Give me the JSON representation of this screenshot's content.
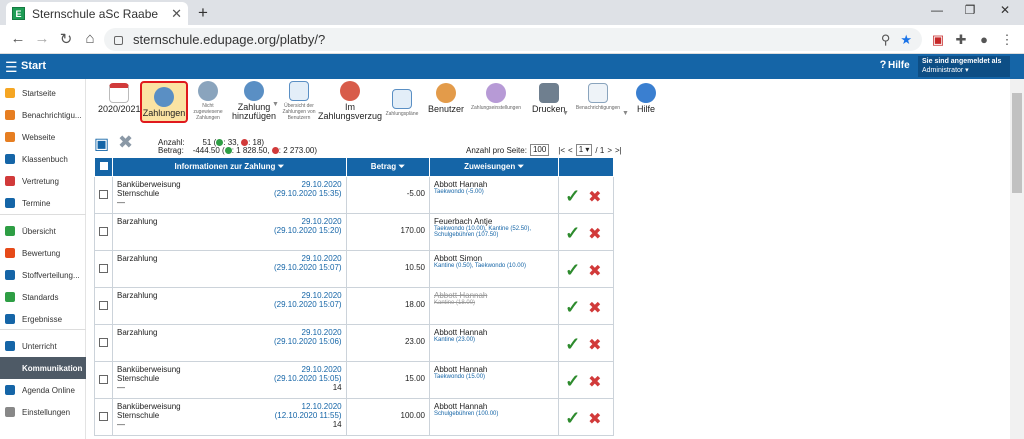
{
  "browser": {
    "tab_title": "Sternschule aSc Raabe",
    "url": "sternschule.edupage.org/platby/?",
    "tab_close": "✕",
    "newtab": "+"
  },
  "header": {
    "start": "Start",
    "help": "Hilfe",
    "user_line1": "Sie sind angemeldet als",
    "user_line2": "Administrator"
  },
  "sidebar": {
    "items": [
      "Startseite",
      "Benachrichtigu...",
      "Webseite",
      "Klassenbuch",
      "Vertretung",
      "Termine",
      "Übersicht",
      "Bewertung",
      "Stoffverteilung...",
      "Standards",
      "Ergebnisse",
      "Unterricht",
      "Kommunikation",
      "Agenda Online",
      "Einstellungen"
    ],
    "colors": [
      "#f5a623",
      "#e67e22",
      "#e67e22",
      "#1565a7",
      "#d13a3a",
      "#1565a7",
      "#2e9e44",
      "#e64a19",
      "#1565a7",
      "#2e9e44",
      "#1565a7",
      "#1565a7",
      "#4e5a66",
      "#1565a7",
      "#888888"
    ]
  },
  "toolbar": {
    "year": "2020/2021",
    "zahlungen": "Zahlungen",
    "nicht": "Nicht zugewiesene Zahlungen",
    "hinzu": "Zahlung hinzufügen",
    "uebersicht": "Übersicht der Zahlungen von Benutzern",
    "verzug": "Im Zahlungsverzug",
    "plaene": "Zahlungspläne",
    "benutzer": "Benutzer",
    "einst": "Zahlungseinstellungen",
    "drucken": "Drucken",
    "benach": "Benachrichtigungen",
    "hilfe": "Hilfe"
  },
  "summary": {
    "anzahl_label": "Anzahl:",
    "anzahl": "51",
    "anzahl_pos": "33,",
    "anzahl_neg": "18)",
    "betrag_label": "Betrag:",
    "betrag": "-444.50",
    "betrag_pos": "1 828.50,",
    "betrag_neg": "2 273.00)"
  },
  "pagination": {
    "per_page_label": "Anzahl pro Seite:",
    "per_page": "100",
    "first": "|<",
    "prev": "<",
    "page": "1",
    "total": "/ 1",
    "next": ">",
    "last": ">|"
  },
  "table": {
    "headers": {
      "info": "Informationen zur Zahlung",
      "betrag": "Betrag",
      "zuweisungen": "Zuweisungen"
    },
    "rows": [
      {
        "type": "Banküberweisung",
        "type2": "Sternschule",
        "extra": "—",
        "date": "29.10.2020",
        "date2": "(29.10.2020 15:35)",
        "num": "",
        "amount": "-5.00",
        "name": "Abbott Hannah",
        "detail": "Taekwondo (-5.00)",
        "detail2": ""
      },
      {
        "type": "Barzahlung",
        "type2": "",
        "extra": "",
        "date": "29.10.2020",
        "date2": "(29.10.2020 15:20)",
        "num": "",
        "amount": "170.00",
        "name": "Feuerbach Antje",
        "detail": "Taekwondo (10.00), Kantine (52.50),",
        "detail2": "Schulgebühren (107.50)"
      },
      {
        "type": "Barzahlung",
        "type2": "",
        "extra": "",
        "date": "29.10.2020",
        "date2": "(29.10.2020 15:07)",
        "num": "",
        "amount": "10.50",
        "name": "Abbott Simon",
        "detail": "Kantine (0.50), Taekwondo (10.00)",
        "detail2": ""
      },
      {
        "type": "Barzahlung",
        "type2": "",
        "extra": "",
        "date": "29.10.2020",
        "date2": "(29.10.2020 15:07)",
        "num": "",
        "amount": "18.00",
        "name": "Abbott Hannah",
        "detail": "Kantine (18.00)",
        "detail2": ""
      },
      {
        "type": "Barzahlung",
        "type2": "",
        "extra": "",
        "date": "29.10.2020",
        "date2": "(29.10.2020 15:06)",
        "num": "",
        "amount": "23.00",
        "name": "Abbott Hannah",
        "detail": "Kantine (23.00)",
        "detail2": ""
      },
      {
        "type": "Banküberweisung",
        "type2": "Sternschule",
        "extra": "—",
        "date": "29.10.2020",
        "date2": "(29.10.2020 15:05)",
        "num": "14",
        "amount": "15.00",
        "name": "Abbott Hannah",
        "detail": "Taekwondo (15.00)",
        "detail2": ""
      },
      {
        "type": "Banküberweisung",
        "type2": "Sternschule",
        "extra": "—",
        "date": "12.10.2020",
        "date2": "(12.10.2020 11:55)",
        "num": "14",
        "amount": "100.00",
        "name": "Abbott Hannah",
        "detail": "Schulgebühren (100.00)",
        "detail2": ""
      }
    ]
  }
}
